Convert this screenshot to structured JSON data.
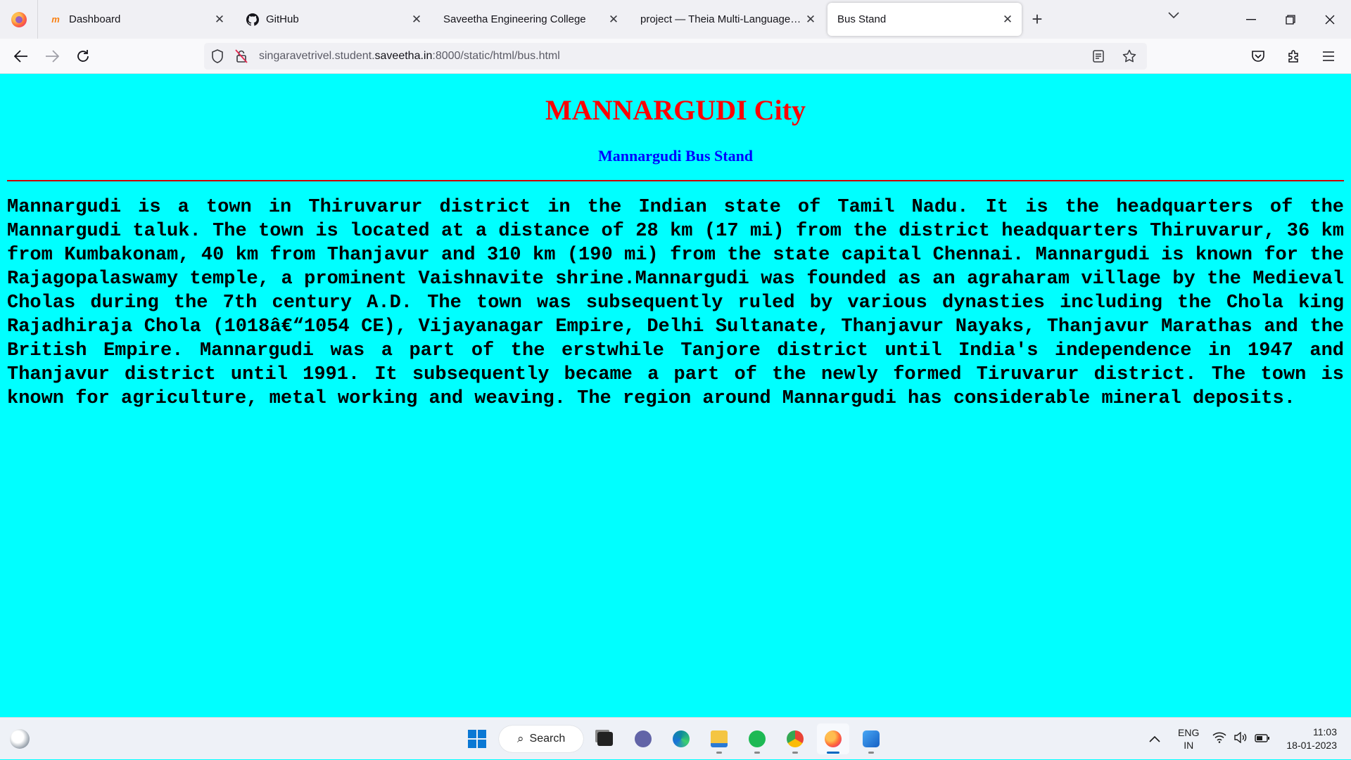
{
  "tabs": [
    {
      "title": "Dashboard",
      "icon": "moodle-icon",
      "active": false
    },
    {
      "title": "GitHub",
      "icon": "github-icon",
      "active": false
    },
    {
      "title": "Saveetha Engineering College",
      "icon": "",
      "active": false
    },
    {
      "title": "project — Theia Multi-Language Ex",
      "icon": "",
      "active": false
    },
    {
      "title": "Bus Stand",
      "icon": "",
      "active": true
    }
  ],
  "url": {
    "prefix": "singaravetrivel.student.",
    "host": "saveetha.in",
    "suffix": ":8000/static/html/bus.html"
  },
  "page": {
    "title": "MANNARGUDI City",
    "subtitle": "Mannargudi Bus Stand",
    "paragraph": "Mannargudi is a town in Thiruvarur district in the Indian state of Tamil Nadu. It is the headquarters of the Mannargudi taluk. The town is located at a distance of 28 km (17 mi) from the district headquarters Thiruvarur, 36 km from Kumbakonam, 40 km from Thanjavur and 310 km (190 mi) from the state capital Chennai. Mannargudi is known for the Rajagopalaswamy temple, a prominent Vaishnavite shrine.Mannargudi was founded as an agraharam village by the Medieval Cholas during the 7th century A.D. The town was subsequently ruled by various dynasties including the Chola king Rajadhiraja Chola (1018â€“1054 CE), Vijayanagar Empire, Delhi Sultanate, Thanjavur Nayaks, Thanjavur Marathas and the British Empire. Mannargudi was a part of the erstwhile Tanjore district until India's independence in 1947 and Thanjavur district until 1991. It subsequently became a part of the newly formed Tiruvarur district. The town is known for agriculture, metal working and weaving. The region around Mannargudi has considerable mineral deposits."
  },
  "colors": {
    "page_bg": "#00ffff",
    "title": "#ff0000",
    "subtitle": "#0000ff",
    "rule": "#cc0000"
  },
  "taskbar": {
    "search_label": "Search",
    "lang_line1": "ENG",
    "lang_line2": "IN",
    "time": "11:03",
    "date": "18-01-2023"
  }
}
